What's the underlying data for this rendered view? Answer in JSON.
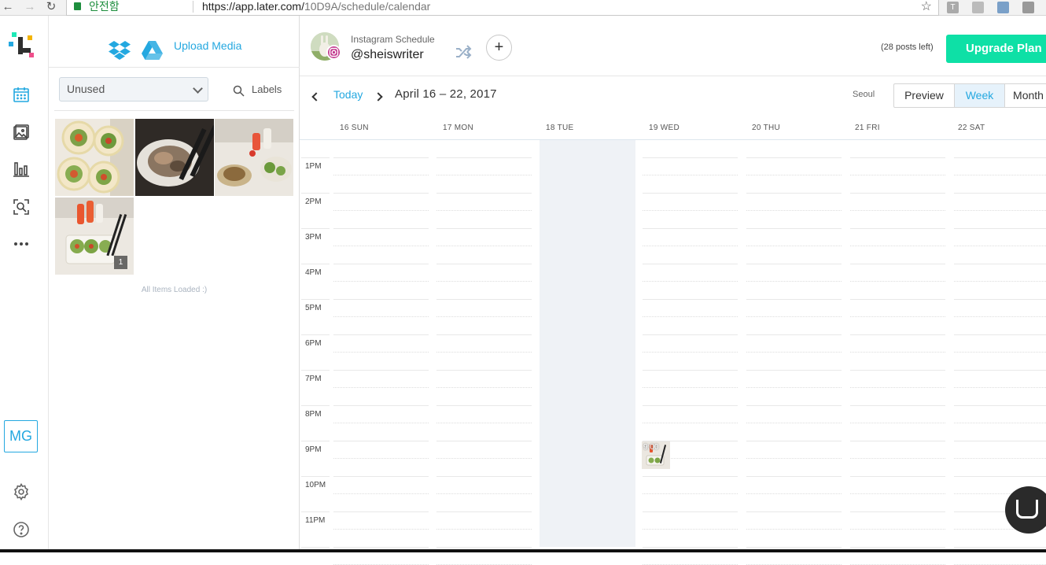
{
  "browser": {
    "security_label": "안전함",
    "url_host": "https://app.later.com/",
    "url_path": "10D9A/schedule/calendar",
    "extensions": [
      "T",
      "pdf",
      "img",
      "search"
    ]
  },
  "sidebar": {
    "items": [
      {
        "name": "calendar",
        "icon": "calendar-icon"
      },
      {
        "name": "media-library",
        "icon": "image-icon"
      },
      {
        "name": "analytics",
        "icon": "bar-chart-icon"
      },
      {
        "name": "search",
        "icon": "search-image-icon"
      },
      {
        "name": "more",
        "icon": "more-dots-icon"
      }
    ],
    "user_initials": "MG"
  },
  "media": {
    "upload_label": "Upload Media",
    "filter_value": "Unused",
    "labels_label": "Labels",
    "thumbnails": [
      {
        "badge": ""
      },
      {
        "badge": ""
      },
      {
        "badge": ""
      },
      {
        "badge": "1"
      }
    ],
    "status": "All Items Loaded :)"
  },
  "header": {
    "schedule_label": "Instagram Schedule",
    "handle": "@sheiswriter",
    "posts_left": "(28 posts left)",
    "upgrade_label": "Upgrade Plan"
  },
  "toolbar": {
    "today_label": "Today",
    "date_range": "April 16 – 22, 2017",
    "timezone": "Seoul",
    "views": [
      "Preview",
      "Week",
      "Month"
    ],
    "active_view": "Week"
  },
  "days": [
    "16 SUN",
    "17 MON",
    "18 TUE",
    "19 WED",
    "20 THU",
    "21 FRI",
    "22 SAT"
  ],
  "hours": [
    "1PM",
    "2PM",
    "3PM",
    "4PM",
    "5PM",
    "6PM",
    "7PM",
    "8PM",
    "9PM",
    "10PM",
    "11PM"
  ],
  "event": {
    "day": "19 WED",
    "time": "9:00"
  },
  "colors": {
    "accent": "#24a8e0",
    "upgrade": "#0ee0a6",
    "today_column": "#eff2f6"
  }
}
